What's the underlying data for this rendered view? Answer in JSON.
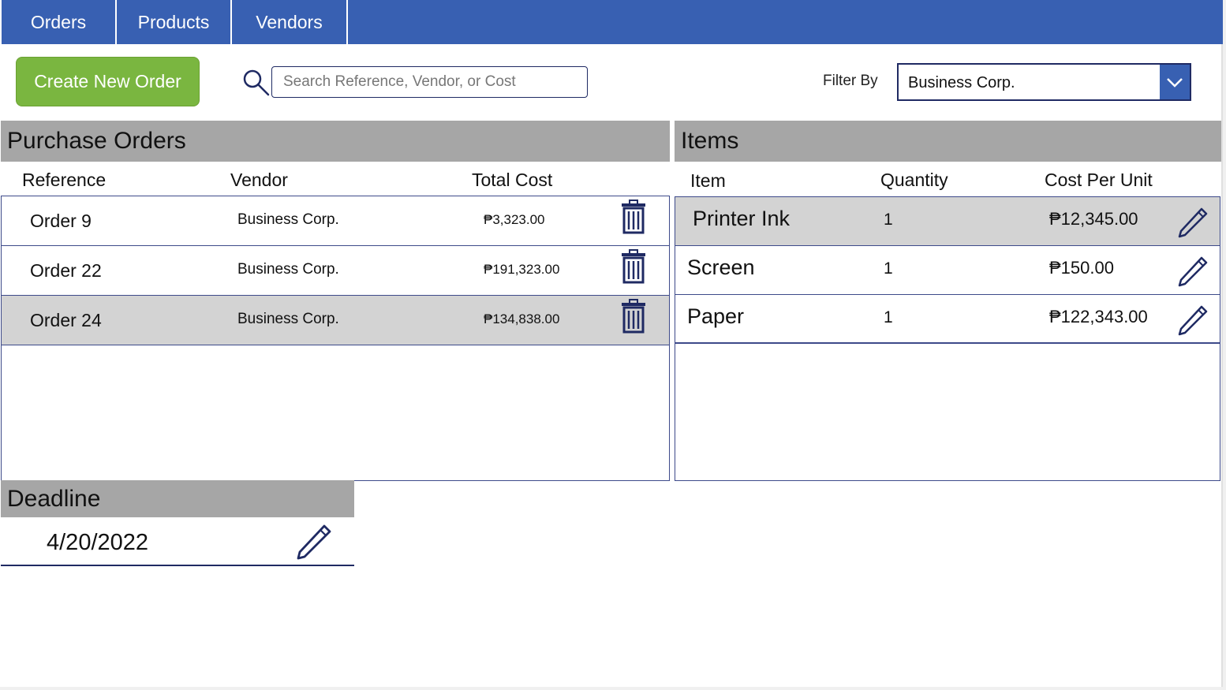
{
  "nav": {
    "tabs": [
      {
        "label": "Orders"
      },
      {
        "label": "Products"
      },
      {
        "label": "Vendors"
      }
    ]
  },
  "toolbar": {
    "create_label": "Create New Order",
    "search_placeholder": "Search Reference, Vendor, or Cost",
    "search_value": "",
    "search_icon": "search-icon",
    "filter_label": "Filter By",
    "filter_value": "Business Corp."
  },
  "orders": {
    "title": "Purchase Orders",
    "columns": {
      "reference": "Reference",
      "vendor": "Vendor",
      "total_cost": "Total Cost"
    },
    "rows": [
      {
        "reference": "Order 9",
        "vendor": "Business Corp.",
        "total_cost": "₱3,323.00",
        "selected": false
      },
      {
        "reference": "Order 22",
        "vendor": "Business Corp.",
        "total_cost": "₱191,323.00",
        "selected": false
      },
      {
        "reference": "Order 24",
        "vendor": "Business Corp.",
        "total_cost": "₱134,838.00",
        "selected": true
      }
    ],
    "row_icon": "trash-icon"
  },
  "items": {
    "title": "Items",
    "columns": {
      "item": "Item",
      "quantity": "Quantity",
      "cost_per_unit": "Cost Per Unit"
    },
    "rows": [
      {
        "item": "Printer Ink",
        "quantity": "1",
        "cost_per_unit": "₱12,345.00",
        "selected": true
      },
      {
        "item": "Screen",
        "quantity": "1",
        "cost_per_unit": "₱150.00",
        "selected": false
      },
      {
        "item": "Paper",
        "quantity": "1",
        "cost_per_unit": "₱122,343.00",
        "selected": false
      }
    ],
    "row_icon": "pencil-icon"
  },
  "deadline": {
    "title": "Deadline",
    "value": "4/20/2022",
    "edit_icon": "pencil-icon"
  },
  "colors": {
    "nav": "#3860b2",
    "create_button": "#7ab640",
    "header_gray": "#a6a6a6",
    "selected_row": "#d3d3d3",
    "icon_navy": "#1f2a63"
  }
}
